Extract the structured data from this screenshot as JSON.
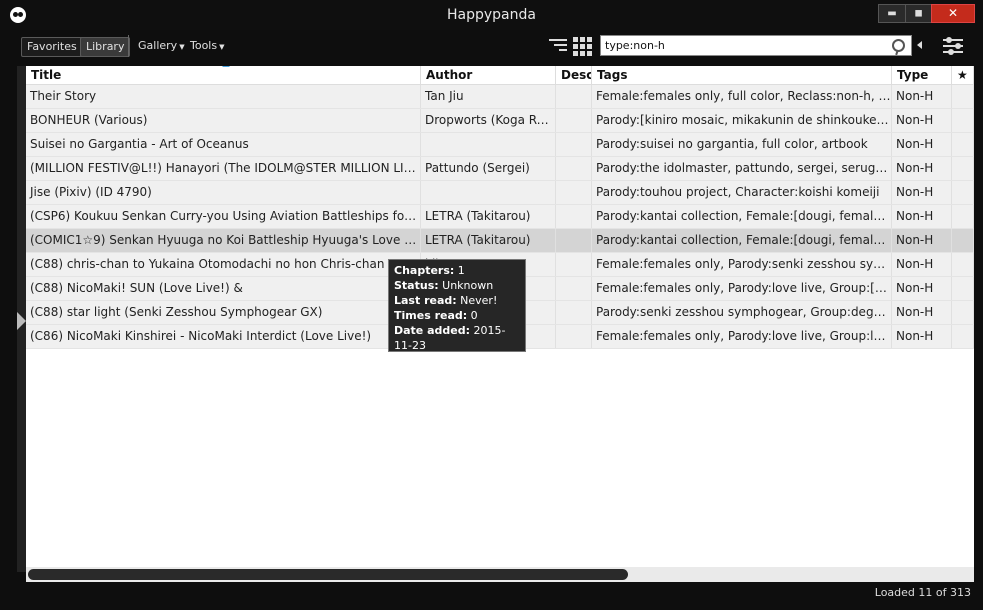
{
  "window": {
    "title": "Happypanda",
    "minimize_label": "▬",
    "maximize_label": "◼",
    "close_label": "✕"
  },
  "toolbar": {
    "favorites_label": "Favorites",
    "library_label": "Library",
    "gallery_label": "Gallery",
    "tools_label": "Tools",
    "search_value": "type:non-h",
    "search_placeholder": ""
  },
  "table": {
    "columns": [
      "Title",
      "Author",
      "Descr",
      "Tags",
      "Type",
      "★"
    ],
    "rows": [
      {
        "title": "Their Story",
        "author": "Tan Jiu",
        "desc": "",
        "tags": "Female:females only, full color, Reclass:non-h, Artist:t...",
        "type": "Non-H",
        "fav": ""
      },
      {
        "title": "BONHEUR (Various)",
        "author": "Dropworts (Koga Rejini)",
        "desc": "",
        "tags": "Parody:[kiniro mosaic, mikakunin de shinkoukei, non ...",
        "type": "Non-H",
        "fav": ""
      },
      {
        "title": "Suisei no Gargantia - Art of Oceanus",
        "author": "",
        "desc": "",
        "tags": "Parody:suisei no gargantia, full color, artbook",
        "type": "Non-H",
        "fav": ""
      },
      {
        "title": "(MILLION FESTIV@L!!)  Hanayori (The IDOLM@STER MILLION LIVE!)",
        "author": "Pattundo (Sergei)",
        "desc": "",
        "tags": "Parody:the idolmaster, pattundo, sergei, serugei, Gro...",
        "type": "Non-H",
        "fav": ""
      },
      {
        "title": "Jise (Pixiv) (ID 4790)",
        "author": "",
        "desc": "",
        "tags": "Parody:touhou project, Character:koishi komeiji",
        "type": "Non-H",
        "fav": ""
      },
      {
        "title": "(CSP6)  Koukuu Senkan Curry-you   Using Aviation Battleships for Curry...",
        "author": "LETRA (Takitarou)",
        "desc": "",
        "tags": "Parody:kantai collection, Female:[dougi, females only...",
        "type": "Non-H",
        "fav": ""
      },
      {
        "title": "(COMIC1☆9)  Senkan Hyuuga no Koi   Battleship Hyuuga's Love (Kanta...",
        "author": "LETRA (Takitarou)",
        "desc": "",
        "tags": "Parody:kantai collection, Female:[dougi, females only...",
        "type": "Non-H",
        "fav": "",
        "selected": true
      },
      {
        "title": "(C88)  chris-chan to Yukaina Otomodachi no hon   Chris-chan and H...",
        "author": "ki)",
        "desc": "",
        "tags": "Female:females only, Parody:senki zesshou symphog...",
        "type": "Non-H",
        "fav": ""
      },
      {
        "title": "(C88)  NicoMaki! SUN (Love Live!)   &",
        "author": "a T...",
        "desc": "",
        "tags": "Female:females only, Parody:love live, Group:[sweet p...",
        "type": "Non-H",
        "fav": ""
      },
      {
        "title": "(C88)  star light (Senki Zesshou Symphogear GX)",
        "author": "a",
        "desc": "",
        "tags": "Parody:senki zesshou symphogear, Group:degarashi., ...",
        "type": "Non-H",
        "fav": ""
      },
      {
        "title": "(C86)  NicoMaki Kinshirei - NicoMaki Interdict (Love Live!)",
        "author": "uto)",
        "desc": "",
        "tags": "Female:females only, Parody:love live, Group:lab-star,...",
        "type": "Non-H",
        "fav": ""
      }
    ]
  },
  "tooltip": {
    "chapters_label": "Chapters:",
    "chapters_value": "1",
    "status_label": "Status:",
    "status_value": "Unknown",
    "last_read_label": "Last read:",
    "last_read_value": "Never!",
    "times_read_label": "Times read:",
    "times_read_value": "0",
    "date_added_label": "Date added:",
    "date_added_value": "2015-11-23"
  },
  "statusbar": {
    "text": "Loaded 11 of 313"
  }
}
